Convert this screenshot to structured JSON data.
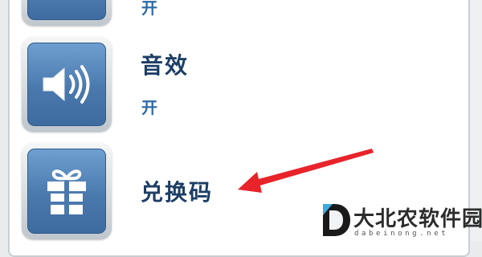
{
  "settings": {
    "items": [
      {
        "name": "",
        "value": "开",
        "icon": "unknown-setting-icon"
      },
      {
        "name": "音效",
        "value": "开",
        "icon": "speaker-icon"
      },
      {
        "name": "兑换码",
        "value": "",
        "icon": "gift-icon"
      }
    ]
  },
  "watermark": {
    "brand": "大北农软件园",
    "url": "dabeinong.net"
  },
  "colors": {
    "button_blue": "#4a79ad",
    "title_text": "#1d3f66",
    "value_text": "#2d6aa6",
    "arrow_red": "#e8232a"
  }
}
